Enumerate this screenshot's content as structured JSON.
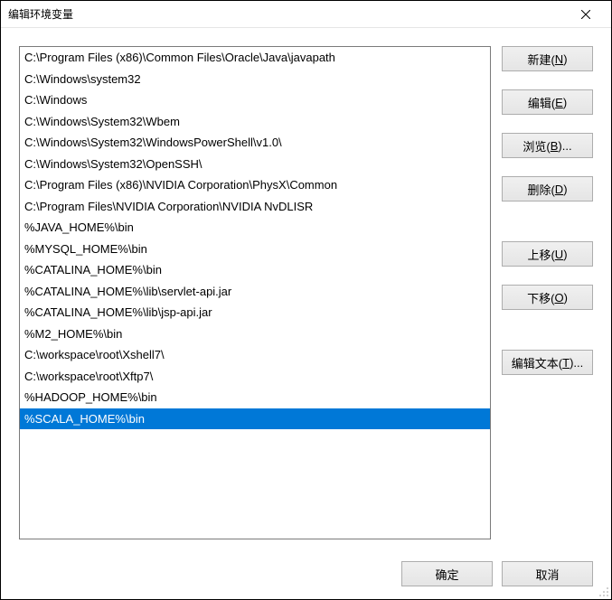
{
  "window": {
    "title": "编辑环境变量"
  },
  "list": {
    "items": [
      "C:\\Program Files (x86)\\Common Files\\Oracle\\Java\\javapath",
      "C:\\Windows\\system32",
      "C:\\Windows",
      "C:\\Windows\\System32\\Wbem",
      "C:\\Windows\\System32\\WindowsPowerShell\\v1.0\\",
      "C:\\Windows\\System32\\OpenSSH\\",
      "C:\\Program Files (x86)\\NVIDIA Corporation\\PhysX\\Common",
      "C:\\Program Files\\NVIDIA Corporation\\NVIDIA NvDLISR",
      "%JAVA_HOME%\\bin",
      "%MYSQL_HOME%\\bin",
      "%CATALINA_HOME%\\bin",
      "%CATALINA_HOME%\\lib\\servlet-api.jar",
      "%CATALINA_HOME%\\lib\\jsp-api.jar",
      "%M2_HOME%\\bin",
      "C:\\workspace\\root\\Xshell7\\",
      "C:\\workspace\\root\\Xftp7\\",
      "%HADOOP_HOME%\\bin",
      "%SCALA_HOME%\\bin"
    ],
    "selected_index": 17
  },
  "buttons": {
    "new_pre": "新建(",
    "new_key": "N",
    "new_post": ")",
    "edit_pre": "编辑(",
    "edit_key": "E",
    "edit_post": ")",
    "browse_pre": "浏览(",
    "browse_key": "B",
    "browse_post": ")...",
    "delete_pre": "删除(",
    "delete_key": "D",
    "delete_post": ")",
    "up_pre": "上移(",
    "up_key": "U",
    "up_post": ")",
    "down_pre": "下移(",
    "down_key": "O",
    "down_post": ")",
    "edittext_pre": "编辑文本(",
    "edittext_key": "T",
    "edittext_post": ")...",
    "ok": "确定",
    "cancel": "取消"
  }
}
